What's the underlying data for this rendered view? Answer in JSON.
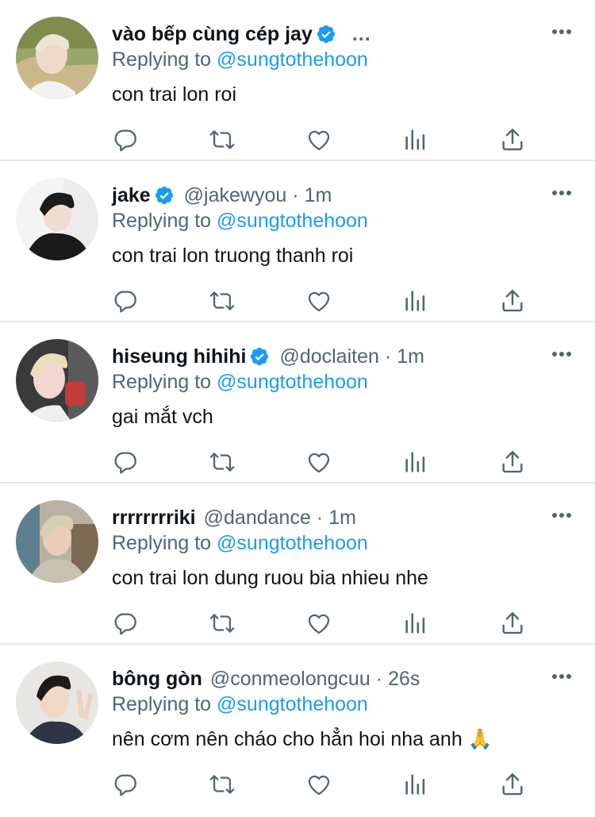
{
  "colors": {
    "accent": "#1d9bf0",
    "secondary_text": "#536471",
    "primary_text": "#0f1419",
    "divider": "#e6e9ec"
  },
  "reply_prefix": "Replying to",
  "tweets": [
    {
      "display_name": "vào bếp cùng cép jay",
      "verified": true,
      "handle": "",
      "time": "",
      "truncated": "...",
      "reply_to": "@sungtothehoon",
      "text": "con trai lon roi"
    },
    {
      "display_name": "jake",
      "verified": true,
      "handle": "@jakewyou",
      "time": "1m",
      "reply_to": "@sungtothehoon",
      "text": "con trai lon truong thanh roi"
    },
    {
      "display_name": "hiseung hihihi",
      "verified": true,
      "handle": "@doclaiten",
      "time": "1m",
      "reply_to": "@sungtothehoon",
      "text": "gai mắt vch"
    },
    {
      "display_name": "rrrrrrrriki",
      "verified": false,
      "handle": "@dandance",
      "time": "1m",
      "reply_to": "@sungtothehoon",
      "text": "con trai lon dung ruou bia nhieu nhe"
    },
    {
      "display_name": "bông gòn",
      "verified": false,
      "handle": "@conmeolongcuu",
      "time": "26s",
      "reply_to": "@sungtothehoon",
      "text": "nên cơm nên cháo cho hẳn hoi nha anh 🙏"
    }
  ],
  "separator": "·"
}
